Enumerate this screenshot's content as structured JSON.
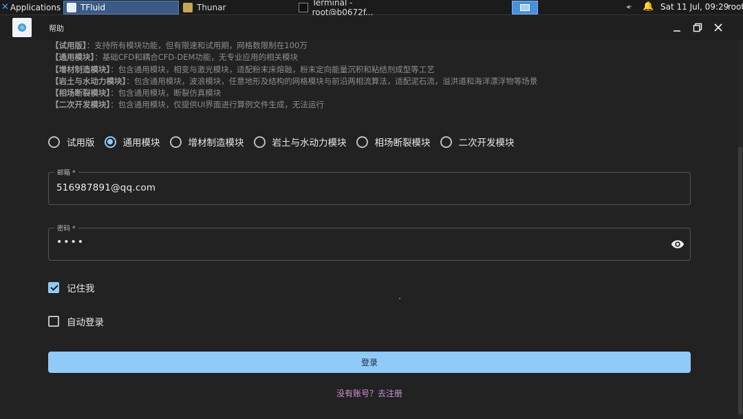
{
  "taskbar": {
    "applications_label": "Applications",
    "tasks": [
      {
        "label": "TFluid",
        "active": true
      },
      {
        "label": "Thunar",
        "active": false
      },
      {
        "label": "Terminal - root@b0672f...",
        "active": false
      }
    ],
    "clock": "Sat 11 Jul, 09:29",
    "user": "root"
  },
  "window": {
    "menu_help": "帮助"
  },
  "descriptions": [
    {
      "name": "【试用版】",
      "text": "：支持所有模块功能，但有限速和试用期，网格数限制在100万"
    },
    {
      "name": "【通用模块】",
      "text": "：基础CFD和耦合CFD-DEM功能，无专业应用的相关模块"
    },
    {
      "name": "【增材制造模块】",
      "text": "：包含通用模块，相变与激光模块，适配粉末床熔融，粉末定向能量沉积和粘结剂成型等工艺"
    },
    {
      "name": "【岩土与水动力模块】",
      "text": "：包含通用模块，波浪模块，任意地形及结构的网格模块与前沿两相流算法，适配泥石流，溢洪道和海洋漂浮物等场景"
    },
    {
      "name": "【相场断裂模块】",
      "text": "：包含通用模块，断裂仿真模块"
    },
    {
      "name": "【二次开发模块】",
      "text": "：包含通用模块，仅提供UI界面进行算例文件生成，无法运行"
    }
  ],
  "modules": {
    "options": [
      "试用版",
      "通用模块",
      "增材制造模块",
      "岩土与水动力模块",
      "相场断裂模块",
      "二次开发模块"
    ],
    "selected": "通用模块"
  },
  "form": {
    "email_label": "邮箱 *",
    "email_value": "516987891@qq.com",
    "password_label": "密码 *",
    "password_masked": "••••",
    "remember_label": "记住我",
    "remember_checked": true,
    "auto_login_label": "自动登录",
    "auto_login_checked": false,
    "login_button": "登录",
    "register_link": "没有账号？去注册"
  }
}
